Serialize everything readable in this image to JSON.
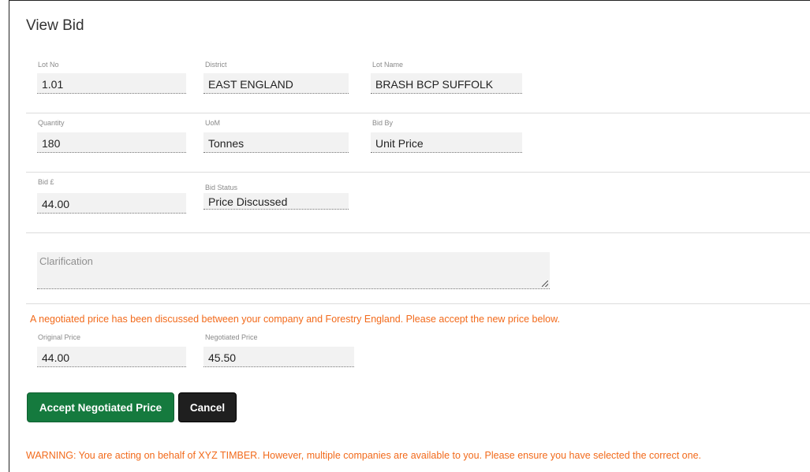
{
  "page": {
    "title": "View Bid"
  },
  "row1": {
    "lot_no_label": "Lot No",
    "lot_no": "1.01",
    "district_label": "District",
    "district": "EAST ENGLAND",
    "lot_name_label": "Lot Name",
    "lot_name": "BRASH BCP SUFFOLK"
  },
  "row2": {
    "quantity_label": "Quantity",
    "quantity": "180",
    "uom_label": "UoM",
    "uom": "Tonnes",
    "bid_by_label": "Bid By",
    "bid_by": "Unit Price"
  },
  "row3": {
    "bid_label": "Bid £",
    "bid": "44.00",
    "status_label": "Bid Status",
    "status": "Price Discussed"
  },
  "clarification": {
    "placeholder": "Clarification"
  },
  "notice": "A negotiated price has been discussed between your company and Forestry England. Please accept the new price below.",
  "prices": {
    "original_label": "Original Price",
    "original": "44.00",
    "negotiated_label": "Negotiated Price",
    "negotiated": "45.50"
  },
  "buttons": {
    "accept": "Accept Negotiated Price",
    "cancel": "Cancel"
  },
  "warning": "WARNING: You are acting on behalf of XYZ TIMBER. However, multiple companies are available to you. Please ensure you have selected the correct one.",
  "colors": {
    "accent_orange": "#f26a1b",
    "accept_green": "#157a3e",
    "cancel_dark": "#1f1f1f"
  }
}
